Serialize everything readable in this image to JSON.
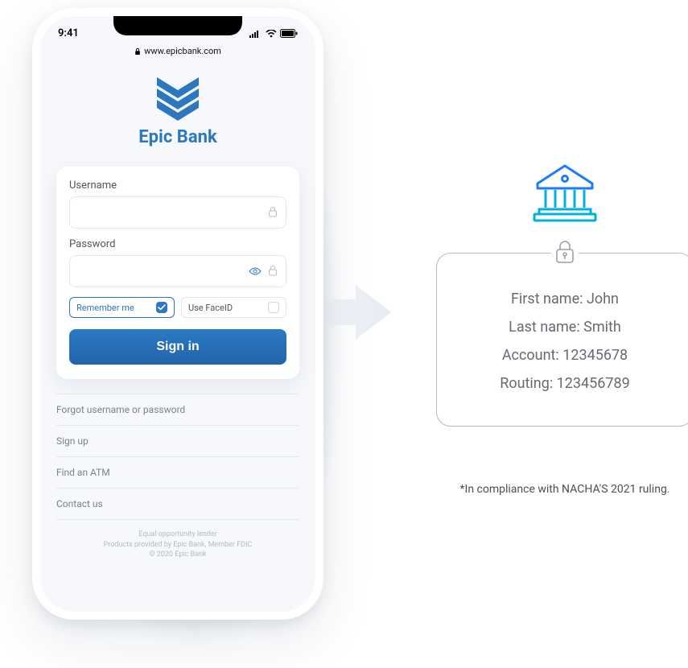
{
  "status": {
    "time": "9:41",
    "url": "www.epicbank.com"
  },
  "brand": {
    "title": "Epic Bank"
  },
  "form": {
    "username_label": "Username",
    "password_label": "Password",
    "remember_label": "Remember me",
    "faceid_label": "Use FaceID",
    "signin": "Sign in"
  },
  "links": {
    "forgot": "Forgot username or password",
    "signup": "Sign up",
    "atm": "Find an ATM",
    "contact": "Contact us"
  },
  "footer": {
    "l1": "Equal opportunity lender",
    "l2": "Products provided by Epic Bank, Member FDIC",
    "l3": "© 2020 Epic Bank"
  },
  "info": {
    "first": "First name: John",
    "last": "Last name: Smith",
    "account": "Account: 12345678",
    "routing": "Routing: 123456789"
  },
  "compliance": "*In compliance with NACHA'S 2021 ruling."
}
